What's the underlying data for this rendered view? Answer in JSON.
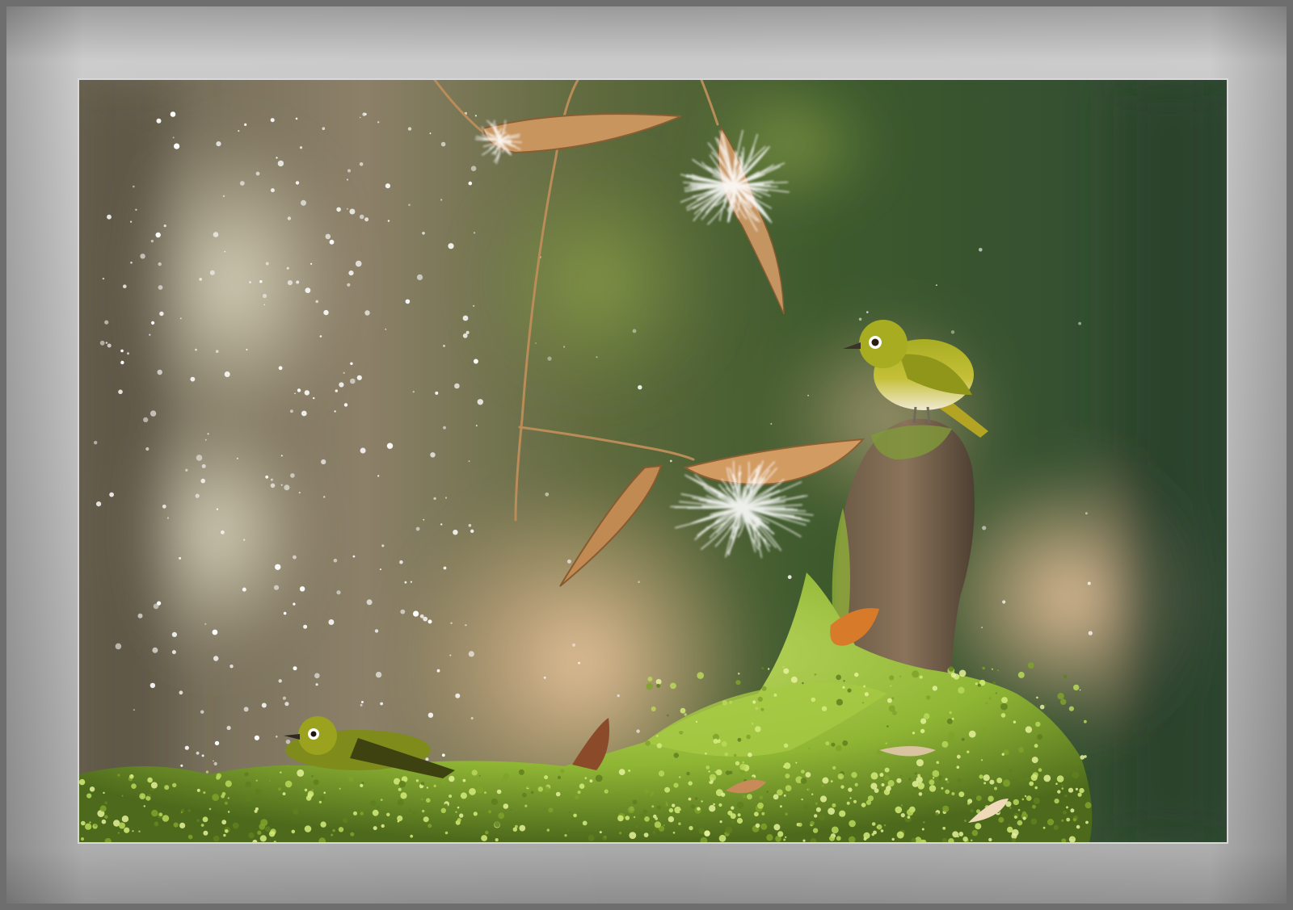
{
  "image": {
    "subject": "photo",
    "colors": {
      "frame_mat": "#bdbdbd",
      "frame_edge": "#6e6e6e",
      "bokeh_green": "#3f5a2c",
      "bokeh_warm": "#e2b892",
      "moss": "#8fb534",
      "bird_olive": "#9aa21e",
      "bird_belly": "#efe6cf",
      "seed_pod": "#c8955f"
    }
  }
}
